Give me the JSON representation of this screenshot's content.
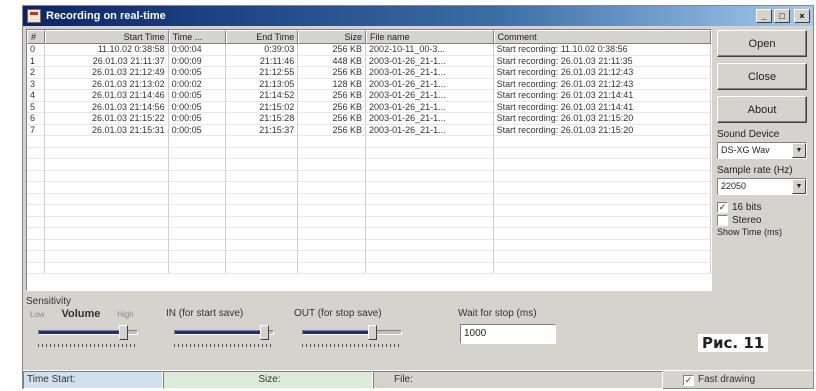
{
  "window": {
    "title": "Recording on real-time"
  },
  "listview": {
    "columns": [
      "#",
      "Start Time",
      "Time ...",
      "End Time",
      "Size",
      "File name",
      "Comment"
    ],
    "rows": [
      [
        "0",
        "11.10.02 0:38:58",
        "0:00:04",
        "0:39:03",
        "256 KB",
        "2002-10-11_00-3...",
        "Start recording: 11.10.02 0:38:56"
      ],
      [
        "1",
        "26.01.03 21:11:37",
        "0:00:09",
        "21:11:46",
        "448 KB",
        "2003-01-26_21-1...",
        "Start recording: 26.01.03 21:11:35"
      ],
      [
        "2",
        "26.01.03 21:12:49",
        "0:00:05",
        "21:12:55",
        "256 KB",
        "2003-01-26_21-1...",
        "Start recording: 26.01.03 21:12:43"
      ],
      [
        "3",
        "26.01.03 21:13:02",
        "0:00:02",
        "21:13:05",
        "128 KB",
        "2003-01-26_21-1...",
        "Start recording: 26.01.03 21:12:43"
      ],
      [
        "4",
        "26.01.03 21:14:46",
        "0:00:05",
        "21:14:52",
        "256 KB",
        "2003-01-26_21-1...",
        "Start recording: 26.01.03 21:14:41"
      ],
      [
        "5",
        "26.01.03 21:14:56",
        "0:00:05",
        "21:15:02",
        "256 KB",
        "2003-01-26_21-1...",
        "Start recording: 26.01.03 21:14:41"
      ],
      [
        "6",
        "26.01.03 21:15:22",
        "0:00:05",
        "21:15:28",
        "256 KB",
        "2003-01-26_21-1...",
        "Start recording: 26.01.03 21:15:20"
      ],
      [
        "7",
        "26.01.03 21:15:31",
        "0:00:05",
        "21:15:37",
        "256 KB",
        "2003-01-26_21-1...",
        "Start recording: 26.01.03 21:15:20"
      ]
    ]
  },
  "buttons": {
    "open": "Open",
    "close": "Close",
    "about": "About"
  },
  "settings": {
    "sound_device_label": "Sound Device",
    "sound_device_value": "DS-XG Wav",
    "sample_rate_label": "Sample rate (Hz)",
    "sample_rate_value": "22050",
    "bits16_label": "16 bits",
    "bits16_checked": true,
    "stereo_label": "Stereo",
    "stereo_checked": false,
    "show_time_label": "Show Time (ms)"
  },
  "sensitivity": {
    "title": "Sensitivity",
    "volume": {
      "low": "Low",
      "label": "Volume",
      "high": "High",
      "level": 0.85
    },
    "in_label": "IN (for start save)",
    "in_level": 0.9,
    "out_label": "OUT (for stop save)",
    "out_level": 0.7,
    "wait_label": "Wait for stop (ms)",
    "wait_value": "1000"
  },
  "caption": "Рис. 11",
  "status": {
    "time_start": "Time Start:",
    "size": "Size:",
    "file": "File:",
    "fast_label": "Fast drawing",
    "fast_checked": true
  }
}
